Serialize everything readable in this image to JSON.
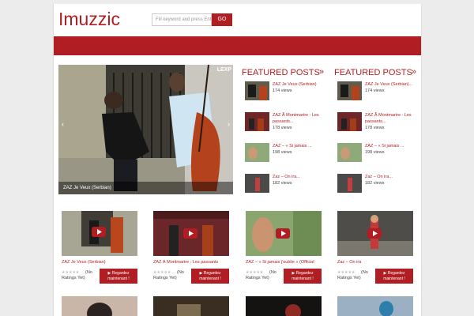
{
  "header": {
    "logo": "Imuzzic",
    "search_placeholder": "Fill keyword and press Enter",
    "search_button": "GO"
  },
  "hero": {
    "caption": "ZAZ Je Veux (Serbian)",
    "watermark": "LEXP",
    "prev": "‹",
    "next": "›"
  },
  "featured": [
    {
      "title": "FEATURED POSTS",
      "arrow": "»",
      "items": [
        {
          "title": "ZAZ Je Veux (Serbian)",
          "views": "174 views"
        },
        {
          "title": "ZAZ Ã  Montmartre : Les passants...",
          "views": "178 views"
        },
        {
          "title": "ZAZ – « Si jamais ...",
          "views": "198 views"
        },
        {
          "title": "Zaz – On ira...",
          "views": "182 views"
        }
      ]
    },
    {
      "title": "FEATURED POSTS",
      "arrow": "»",
      "items": [
        {
          "title": "ZAZ Je Veux (Serbian)...",
          "views": "174 views"
        },
        {
          "title": "ZAZ Ã  Montmartre : Les passants...",
          "views": "178 views"
        },
        {
          "title": "ZAZ – « Si jamais ...",
          "views": "198 views"
        },
        {
          "title": "Zaz – On ira...",
          "views": "182 views"
        }
      ]
    }
  ],
  "cards": [
    {
      "title": "ZAZ Je Veux (Serbian)",
      "ratings_a": "(No",
      "ratings_b": "Ratings Yet)",
      "button": "▶ Regardez maintenant !"
    },
    {
      "title": "ZAZ Ã  Montmartre : Les passants",
      "ratings_a": "(No",
      "ratings_b": "Ratings Yet)",
      "button": "▶ Regardez maintenant !"
    },
    {
      "title": "ZAZ – « Si jamais j'oublie » (Official",
      "ratings_a": "(No",
      "ratings_b": "Ratings Yet)",
      "button": "▶ Regardez maintenant !"
    },
    {
      "title": "Zaz – On ira",
      "ratings_a": "(No",
      "ratings_b": "Ratings Yet)",
      "button": "▶ Regardez maintenant !"
    }
  ],
  "stars": "★★★★★",
  "colors": {
    "accent": "#b01e23",
    "background": "#ececec"
  }
}
